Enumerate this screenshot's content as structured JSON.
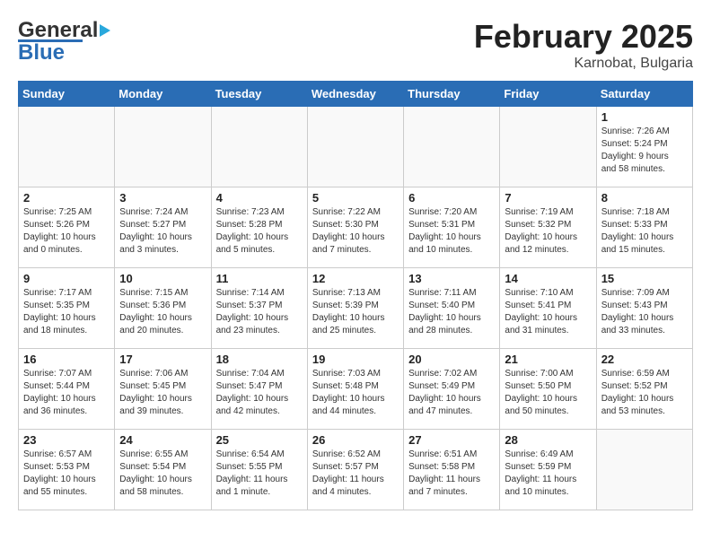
{
  "header": {
    "logo_general": "General",
    "logo_blue": "Blue",
    "title": "February 2025",
    "location": "Karnobat, Bulgaria"
  },
  "weekdays": [
    "Sunday",
    "Monday",
    "Tuesday",
    "Wednesday",
    "Thursday",
    "Friday",
    "Saturday"
  ],
  "weeks": [
    [
      {
        "day": "",
        "info": ""
      },
      {
        "day": "",
        "info": ""
      },
      {
        "day": "",
        "info": ""
      },
      {
        "day": "",
        "info": ""
      },
      {
        "day": "",
        "info": ""
      },
      {
        "day": "",
        "info": ""
      },
      {
        "day": "1",
        "info": "Sunrise: 7:26 AM\nSunset: 5:24 PM\nDaylight: 9 hours\nand 58 minutes."
      }
    ],
    [
      {
        "day": "2",
        "info": "Sunrise: 7:25 AM\nSunset: 5:26 PM\nDaylight: 10 hours\nand 0 minutes."
      },
      {
        "day": "3",
        "info": "Sunrise: 7:24 AM\nSunset: 5:27 PM\nDaylight: 10 hours\nand 3 minutes."
      },
      {
        "day": "4",
        "info": "Sunrise: 7:23 AM\nSunset: 5:28 PM\nDaylight: 10 hours\nand 5 minutes."
      },
      {
        "day": "5",
        "info": "Sunrise: 7:22 AM\nSunset: 5:30 PM\nDaylight: 10 hours\nand 7 minutes."
      },
      {
        "day": "6",
        "info": "Sunrise: 7:20 AM\nSunset: 5:31 PM\nDaylight: 10 hours\nand 10 minutes."
      },
      {
        "day": "7",
        "info": "Sunrise: 7:19 AM\nSunset: 5:32 PM\nDaylight: 10 hours\nand 12 minutes."
      },
      {
        "day": "8",
        "info": "Sunrise: 7:18 AM\nSunset: 5:33 PM\nDaylight: 10 hours\nand 15 minutes."
      }
    ],
    [
      {
        "day": "9",
        "info": "Sunrise: 7:17 AM\nSunset: 5:35 PM\nDaylight: 10 hours\nand 18 minutes."
      },
      {
        "day": "10",
        "info": "Sunrise: 7:15 AM\nSunset: 5:36 PM\nDaylight: 10 hours\nand 20 minutes."
      },
      {
        "day": "11",
        "info": "Sunrise: 7:14 AM\nSunset: 5:37 PM\nDaylight: 10 hours\nand 23 minutes."
      },
      {
        "day": "12",
        "info": "Sunrise: 7:13 AM\nSunset: 5:39 PM\nDaylight: 10 hours\nand 25 minutes."
      },
      {
        "day": "13",
        "info": "Sunrise: 7:11 AM\nSunset: 5:40 PM\nDaylight: 10 hours\nand 28 minutes."
      },
      {
        "day": "14",
        "info": "Sunrise: 7:10 AM\nSunset: 5:41 PM\nDaylight: 10 hours\nand 31 minutes."
      },
      {
        "day": "15",
        "info": "Sunrise: 7:09 AM\nSunset: 5:43 PM\nDaylight: 10 hours\nand 33 minutes."
      }
    ],
    [
      {
        "day": "16",
        "info": "Sunrise: 7:07 AM\nSunset: 5:44 PM\nDaylight: 10 hours\nand 36 minutes."
      },
      {
        "day": "17",
        "info": "Sunrise: 7:06 AM\nSunset: 5:45 PM\nDaylight: 10 hours\nand 39 minutes."
      },
      {
        "day": "18",
        "info": "Sunrise: 7:04 AM\nSunset: 5:47 PM\nDaylight: 10 hours\nand 42 minutes."
      },
      {
        "day": "19",
        "info": "Sunrise: 7:03 AM\nSunset: 5:48 PM\nDaylight: 10 hours\nand 44 minutes."
      },
      {
        "day": "20",
        "info": "Sunrise: 7:02 AM\nSunset: 5:49 PM\nDaylight: 10 hours\nand 47 minutes."
      },
      {
        "day": "21",
        "info": "Sunrise: 7:00 AM\nSunset: 5:50 PM\nDaylight: 10 hours\nand 50 minutes."
      },
      {
        "day": "22",
        "info": "Sunrise: 6:59 AM\nSunset: 5:52 PM\nDaylight: 10 hours\nand 53 minutes."
      }
    ],
    [
      {
        "day": "23",
        "info": "Sunrise: 6:57 AM\nSunset: 5:53 PM\nDaylight: 10 hours\nand 55 minutes."
      },
      {
        "day": "24",
        "info": "Sunrise: 6:55 AM\nSunset: 5:54 PM\nDaylight: 10 hours\nand 58 minutes."
      },
      {
        "day": "25",
        "info": "Sunrise: 6:54 AM\nSunset: 5:55 PM\nDaylight: 11 hours\nand 1 minute."
      },
      {
        "day": "26",
        "info": "Sunrise: 6:52 AM\nSunset: 5:57 PM\nDaylight: 11 hours\nand 4 minutes."
      },
      {
        "day": "27",
        "info": "Sunrise: 6:51 AM\nSunset: 5:58 PM\nDaylight: 11 hours\nand 7 minutes."
      },
      {
        "day": "28",
        "info": "Sunrise: 6:49 AM\nSunset: 5:59 PM\nDaylight: 11 hours\nand 10 minutes."
      },
      {
        "day": "",
        "info": ""
      }
    ]
  ]
}
